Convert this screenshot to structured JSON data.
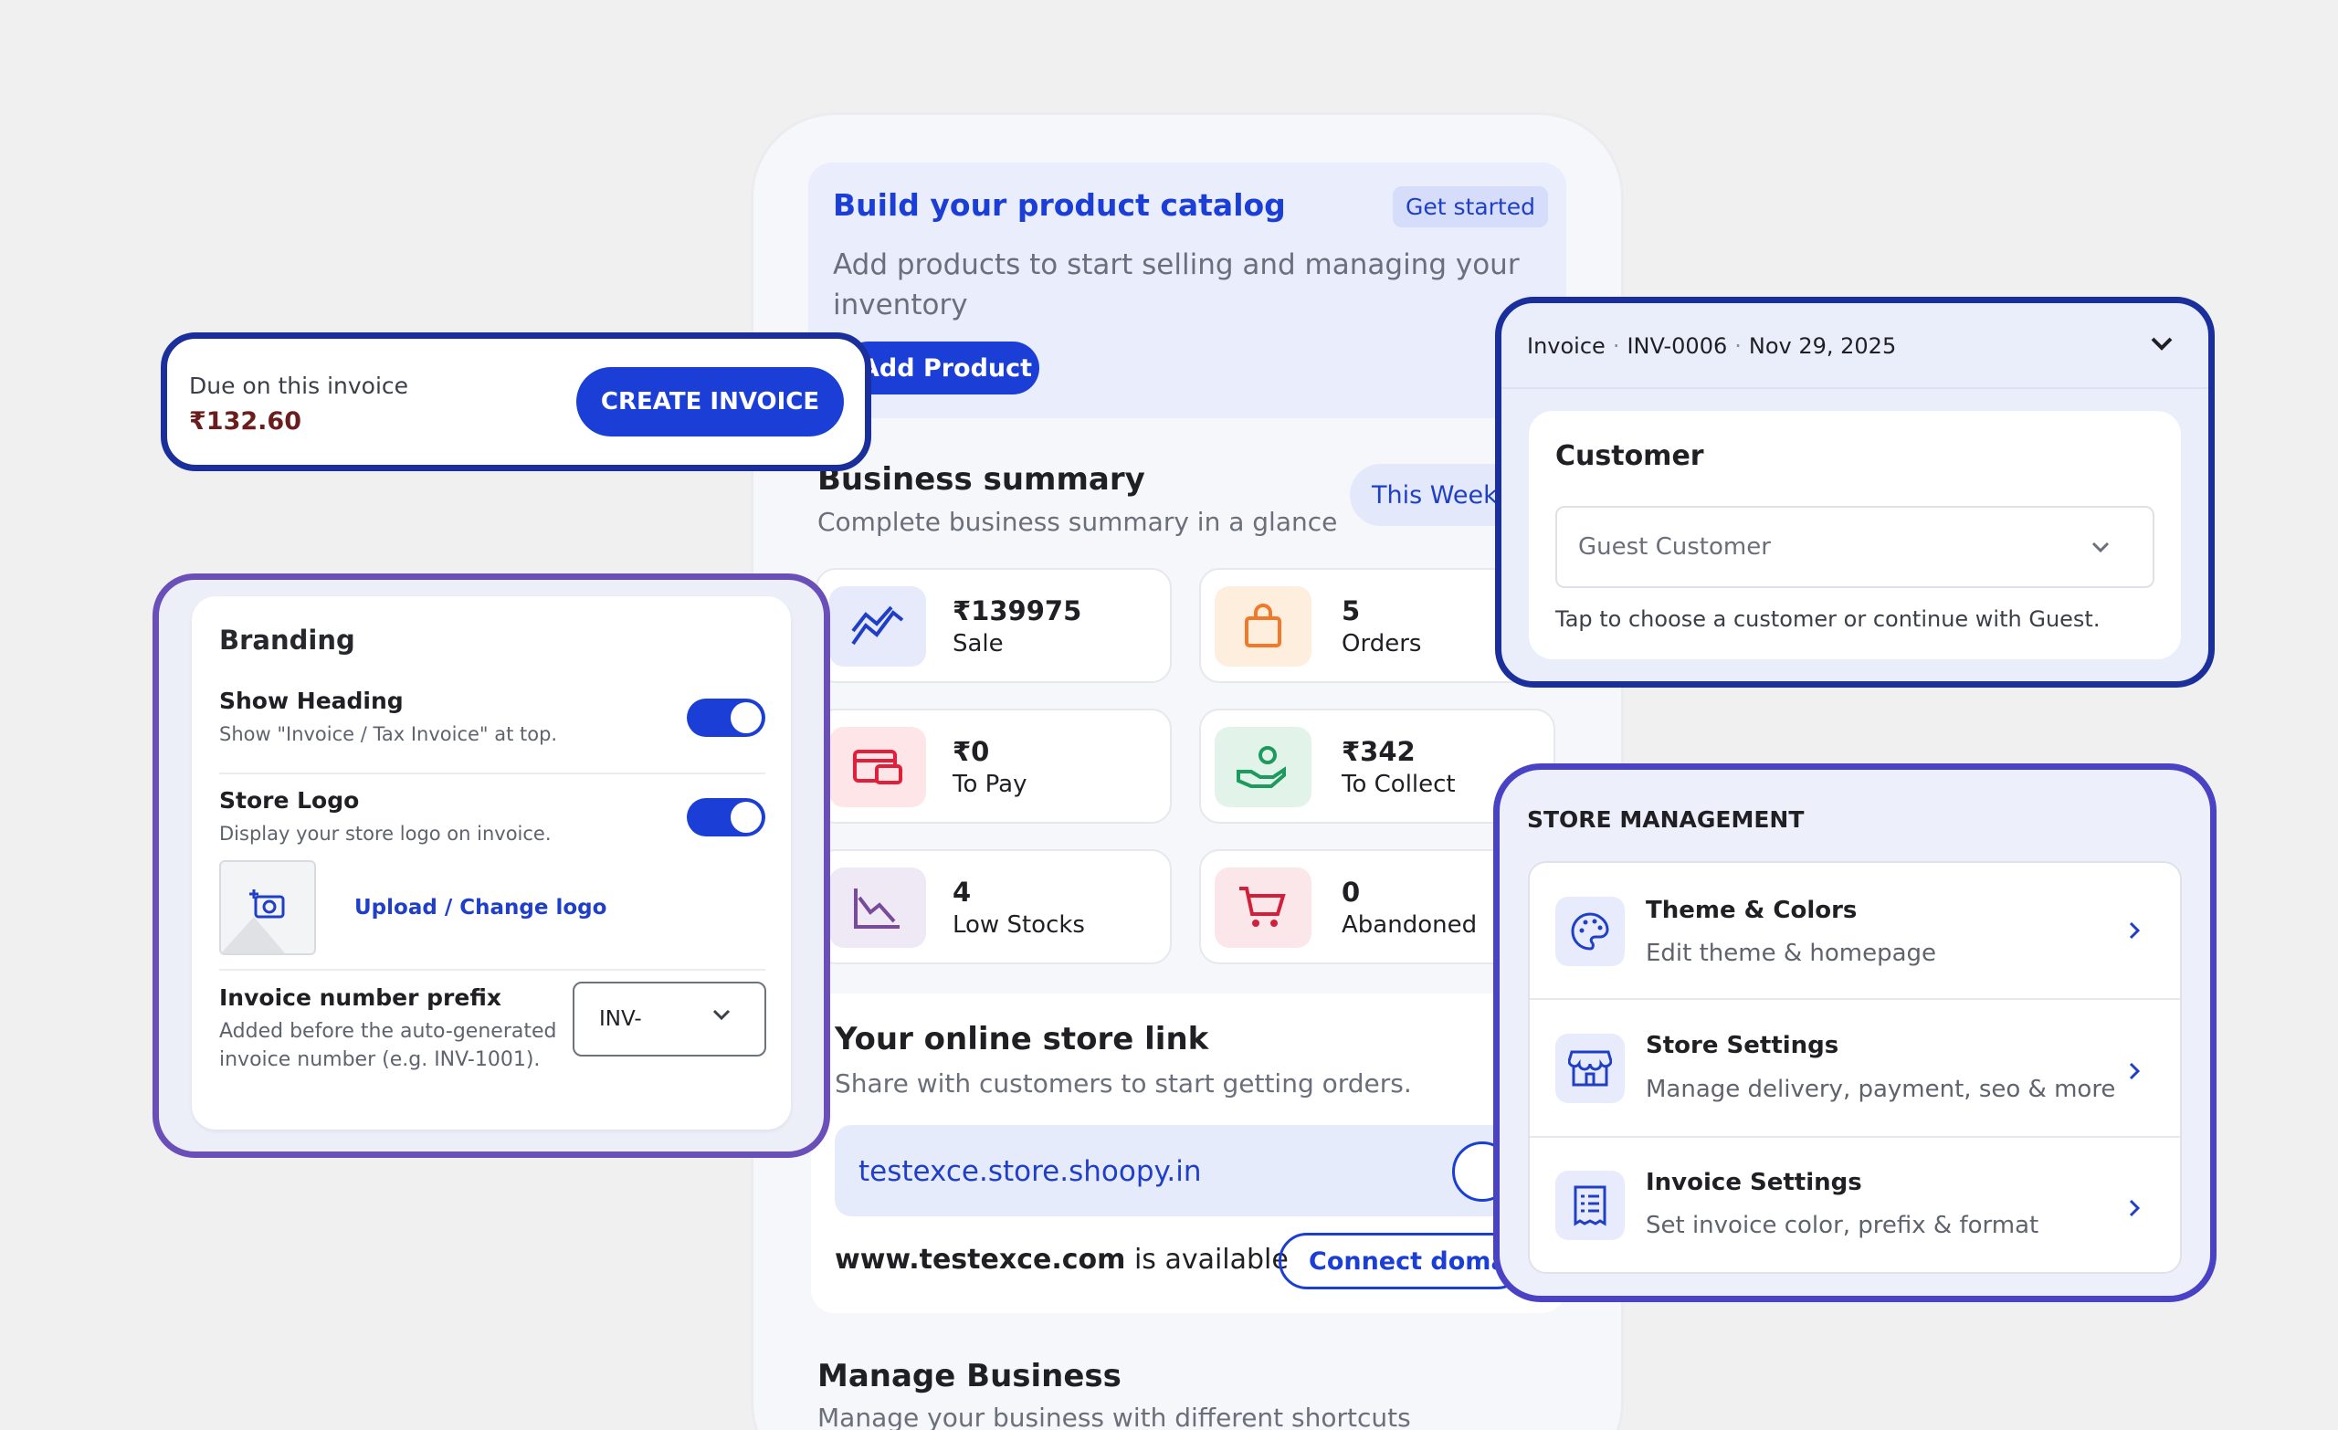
{
  "catalog": {
    "title": "Build your product catalog",
    "cta": "Get started",
    "description": "Add products to start selling and managing your inventory",
    "button": "Add Product"
  },
  "summary": {
    "title": "Business summary",
    "subtitle": "Complete business summary in a glance",
    "period": "This Week",
    "tiles": [
      {
        "value": "₹139975",
        "label": "Sale",
        "icon": "trend-icon",
        "bg": "#e6eafb"
      },
      {
        "value": "5",
        "label": "Orders",
        "icon": "shopping-bag-icon",
        "bg": "#fdeedd"
      },
      {
        "value": "₹0",
        "label": "To Pay",
        "icon": "payment-icon",
        "bg": "#fde5e8"
      },
      {
        "value": "₹342",
        "label": "To Collect",
        "icon": "hand-coin-icon",
        "bg": "#e2f4ea"
      },
      {
        "value": "4",
        "label": "Low Stocks",
        "icon": "chart-decline-icon",
        "bg": "#efe8f5"
      },
      {
        "value": "0",
        "label": "Abandoned",
        "icon": "cart-cancel-icon",
        "bg": "#fbe6e9"
      }
    ]
  },
  "store_link": {
    "title": "Your online store link",
    "subtitle": "Share with customers to start getting orders.",
    "url": "testexce.store.shoopy.in",
    "domain": "www.testexce.com",
    "available_text": "is available",
    "connect": "Connect domain"
  },
  "manage": {
    "title": "Manage Business",
    "subtitle": "Manage your business with different shortcuts"
  },
  "due": {
    "label": "Due on this invoice",
    "amount": "₹132.60",
    "button": "CREATE INVOICE"
  },
  "branding": {
    "title": "Branding",
    "show_heading": {
      "title": "Show Heading",
      "subtitle": "Show \"Invoice / Tax Invoice\" at top.",
      "enabled": true
    },
    "store_logo": {
      "title": "Store Logo",
      "subtitle": "Display your store logo on invoice.",
      "enabled": true
    },
    "upload_link": "Upload / Change logo",
    "prefix": {
      "title": "Invoice number prefix",
      "description": "Added before the auto-generated invoice number (e.g. INV-1001).",
      "value": "INV-"
    }
  },
  "invoice": {
    "label": "Invoice",
    "number": "INV-0006",
    "date": "Nov 29, 2025",
    "customer_title": "Customer",
    "customer_value": "Guest Customer",
    "customer_hint": "Tap to choose a customer or continue with Guest."
  },
  "store_management": {
    "title": "STORE MANAGEMENT",
    "items": [
      {
        "title": "Theme & Colors",
        "subtitle": "Edit theme & homepage",
        "icon": "palette-icon"
      },
      {
        "title": "Store Settings",
        "subtitle": "Manage delivery, payment, seo & more",
        "icon": "storefront-icon"
      },
      {
        "title": "Invoice Settings",
        "subtitle": "Set invoice color, prefix & format",
        "icon": "receipt-icon"
      }
    ]
  },
  "colors": {
    "primary": "#1b3fd6",
    "accent_dark": "#1a2f9c",
    "branding_border": "#6a4fb9",
    "store_mgmt_border": "#4a42c4"
  }
}
